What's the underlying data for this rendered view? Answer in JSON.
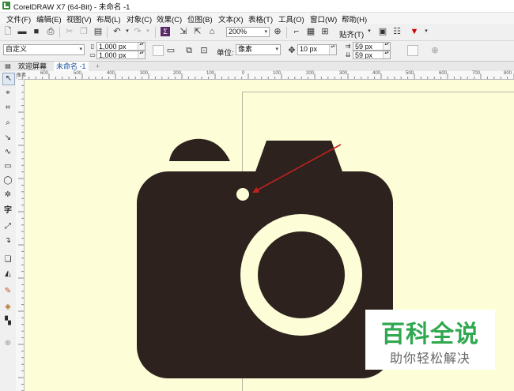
{
  "window": {
    "title": "CorelDRAW X7 (64-Bit) - 未命名 -1"
  },
  "menu": [
    "文件(F)",
    "编辑(E)",
    "视图(V)",
    "布局(L)",
    "对象(C)",
    "效果(C)",
    "位图(B)",
    "文本(X)",
    "表格(T)",
    "工具(O)",
    "窗口(W)",
    "帮助(H)"
  ],
  "toolbar": {
    "zoom": "200%",
    "snap_label": "贴齐(T)"
  },
  "property_bar": {
    "page_preset": "自定义",
    "width": "1,000 px",
    "height": "1,000 px",
    "units_label": "单位:",
    "units_value": "像素",
    "nudge": "10 px",
    "dup_x": "59 px",
    "dup_y": "59 px"
  },
  "tabs": [
    "欢迎屏幕",
    "未命名 -1"
  ],
  "ruler": {
    "h_labels": [
      "600",
      "500",
      "400",
      "300",
      "200",
      "100",
      "0",
      "100",
      "200",
      "300",
      "400",
      "500",
      "600",
      "700",
      "800"
    ],
    "unit": "像素"
  },
  "watermark": {
    "title": "百科全说",
    "subtitle": "助你轻松解决"
  },
  "colors": {
    "camera": "#2d221d",
    "canvas": "#fdfdd8",
    "arrow": "#c0221f",
    "watermark_green": "#2fa84f"
  }
}
